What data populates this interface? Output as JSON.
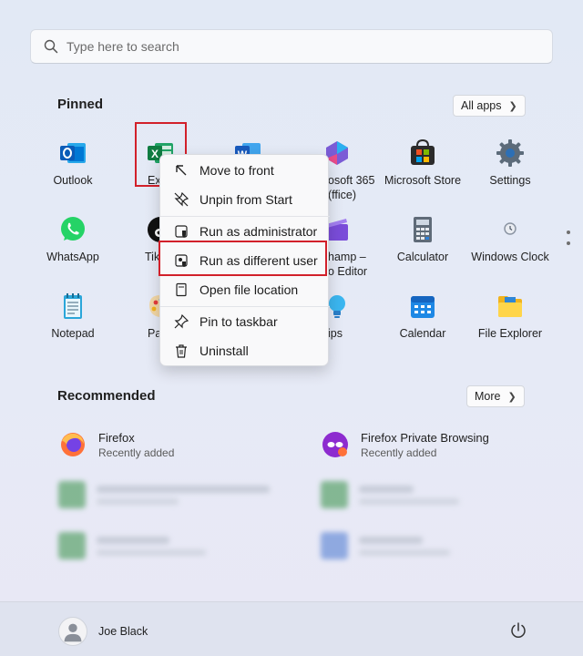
{
  "search": {
    "placeholder": "Type here to search"
  },
  "pinned": {
    "title": "Pinned",
    "all_apps_label": "All apps",
    "apps": [
      {
        "label": "Outlook",
        "icon": "outlook-icon"
      },
      {
        "label": "Ex",
        "icon": "excel-icon"
      },
      {
        "label": "",
        "icon": "word-icon"
      },
      {
        "label": "osoft 365\n(ffice)",
        "icon": "microsoft-365-icon"
      },
      {
        "label": "Microsoft Store",
        "icon": "store-icon"
      },
      {
        "label": "Settings",
        "icon": "gear-icon"
      },
      {
        "label": "WhatsApp",
        "icon": "whatsapp-icon"
      },
      {
        "label": "Tik",
        "icon": "tiktok-icon"
      },
      {
        "label": "hamp –\no Editor",
        "icon": "clipchamp-icon"
      },
      {
        "label": "Calculator",
        "icon": "calculator-icon"
      },
      {
        "label": "Windows Clock",
        "icon": "clock-icon"
      },
      {
        "label": "Notepad",
        "icon": "notepad-icon"
      },
      {
        "label": "Pa",
        "icon": "paint-icon"
      },
      {
        "label": "ips",
        "icon": "tips-icon"
      },
      {
        "label": "Calendar",
        "icon": "calendar-icon"
      },
      {
        "label": "File Explorer",
        "icon": "folder-icon"
      }
    ]
  },
  "context_menu": {
    "items": [
      {
        "label": "Move to front",
        "icon": "arrow-up-left-icon"
      },
      {
        "label": "Unpin from Start",
        "icon": "unpin-icon"
      },
      {
        "label": "Run as administrator",
        "icon": "shield-icon"
      },
      {
        "label": "Run as different user",
        "icon": "user-shield-icon"
      },
      {
        "label": "Open file location",
        "icon": "folder-open-icon"
      },
      {
        "label": "Pin to taskbar",
        "icon": "pin-icon"
      },
      {
        "label": "Uninstall",
        "icon": "trash-icon"
      }
    ]
  },
  "recommended": {
    "title": "Recommended",
    "more_label": "More",
    "items": [
      {
        "name": "Firefox",
        "sub": "Recently added",
        "icon": "firefox-icon"
      },
      {
        "name": "Firefox Private Browsing",
        "sub": "Recently added",
        "icon": "firefox-private-icon"
      }
    ]
  },
  "footer": {
    "user_name": "Joe Black"
  },
  "colors": {
    "highlight": "#d2202a",
    "accent": "#0078d4"
  }
}
